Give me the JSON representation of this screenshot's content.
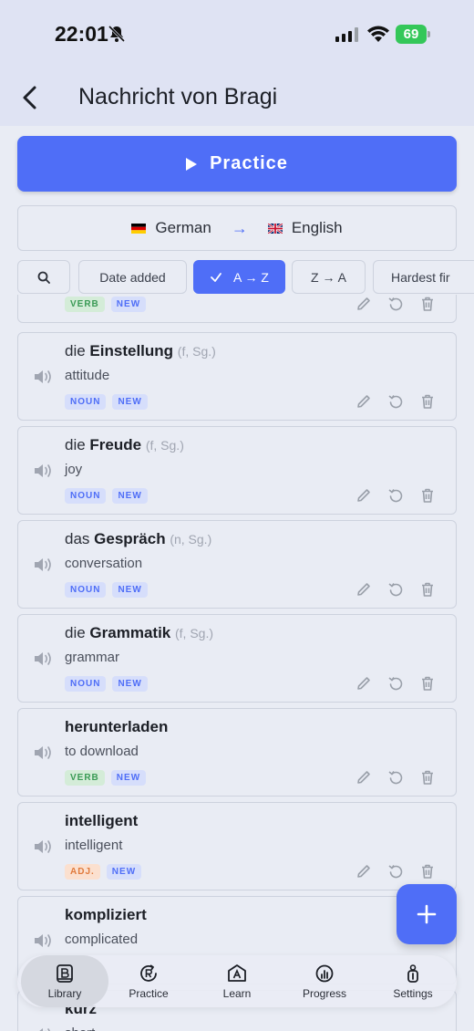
{
  "status": {
    "time": "22:01",
    "battery": "69"
  },
  "header": {
    "title": "Nachricht von Bragi"
  },
  "practice_button": {
    "label": "Practice"
  },
  "languages": {
    "from": "German",
    "to": "English"
  },
  "filters": [
    "Date added",
    "A → Z",
    "Z → A",
    "Hardest fir"
  ],
  "cards": [
    {
      "article": "",
      "word": "",
      "meta": "",
      "translation": "",
      "tags": [
        "VERB",
        "NEW"
      ]
    },
    {
      "article": "die",
      "word": "Einstellung",
      "meta": "(f, Sg.)",
      "translation": "attitude",
      "tags": [
        "NOUN",
        "NEW"
      ]
    },
    {
      "article": "die",
      "word": "Freude",
      "meta": "(f, Sg.)",
      "translation": "joy",
      "tags": [
        "NOUN",
        "NEW"
      ]
    },
    {
      "article": "das",
      "word": "Gespräch",
      "meta": "(n, Sg.)",
      "translation": "conversation",
      "tags": [
        "NOUN",
        "NEW"
      ]
    },
    {
      "article": "die",
      "word": "Grammatik",
      "meta": "(f, Sg.)",
      "translation": "grammar",
      "tags": [
        "NOUN",
        "NEW"
      ]
    },
    {
      "article": "",
      "word": "herunterladen",
      "meta": "",
      "translation": "to download",
      "tags": [
        "VERB",
        "NEW"
      ]
    },
    {
      "article": "",
      "word": "intelligent",
      "meta": "",
      "translation": "intelligent",
      "tags": [
        "ADJ.",
        "NEW"
      ]
    },
    {
      "article": "",
      "word": "kompliziert",
      "meta": "",
      "translation": "complicated",
      "tags": []
    },
    {
      "article": "",
      "word": "kurz",
      "meta": "",
      "translation": "short",
      "tags": []
    }
  ],
  "nav": [
    "Library",
    "Practice",
    "Learn",
    "Progress",
    "Settings"
  ],
  "colors": {
    "accent": "#4f6ef7",
    "verb": "#3a9a55",
    "adj": "#e07a3c"
  }
}
